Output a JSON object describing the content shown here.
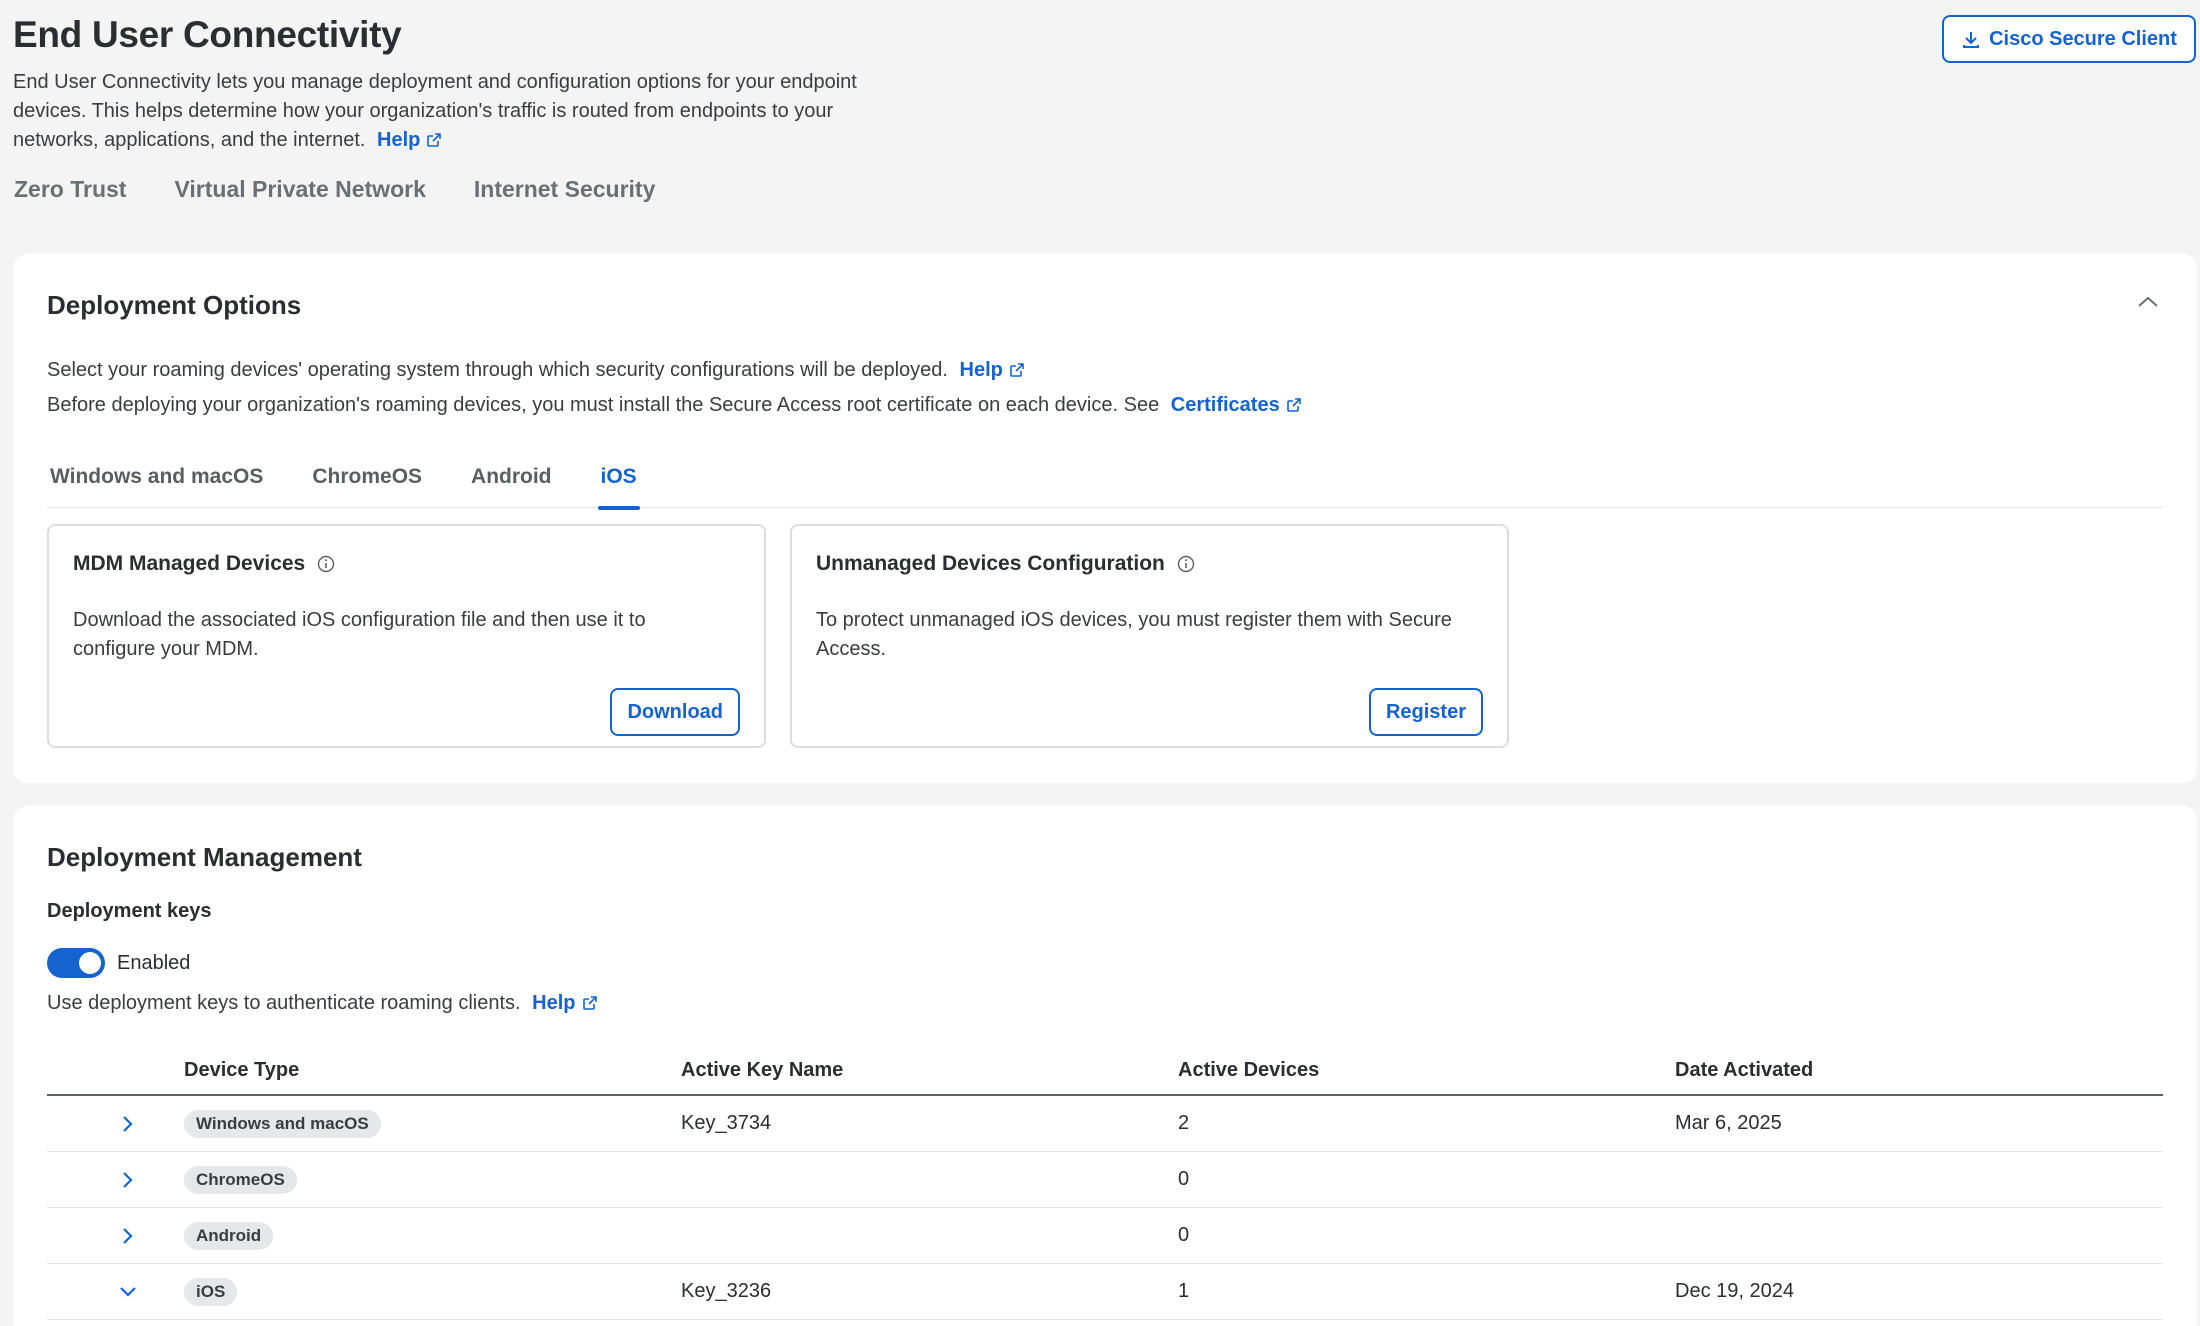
{
  "header": {
    "title": "End User Connectivity",
    "description": "End User Connectivity lets you manage deployment and configuration options for your endpoint devices. This helps determine how your organization's traffic is routed from endpoints to your networks, applications, and the internet.",
    "help_label": "Help",
    "cisco_button_label": "Cisco Secure Client",
    "tabs": [
      "Zero Trust",
      "Virtual Private Network",
      "Internet Security"
    ]
  },
  "deployment_options": {
    "title": "Deployment Options",
    "line1": "Select your roaming devices' operating system through which security configurations will be deployed.",
    "line1_link": "Help",
    "line2": "Before deploying your organization's roaming devices, you must install the Secure Access root certificate on each device. See",
    "line2_link": "Certificates",
    "os_tabs": [
      "Windows and macOS",
      "ChromeOS",
      "Android",
      "iOS"
    ],
    "active_tab": "iOS",
    "cards": [
      {
        "title": "MDM Managed Devices",
        "body": "Download the associated iOS configuration file and then use it to configure your MDM.",
        "button": "Download"
      },
      {
        "title": "Unmanaged Devices Configuration",
        "body": "To protect unmanaged iOS devices, you must register them with Secure Access.",
        "button": "Register"
      }
    ]
  },
  "deployment_management": {
    "title": "Deployment Management",
    "keys_title": "Deployment keys",
    "toggle_label": "Enabled",
    "toggle_on": true,
    "keys_desc": "Use deployment keys to authenticate roaming clients.",
    "keys_help": "Help",
    "table": {
      "headers": [
        "Device Type",
        "Active Key Name",
        "Active Devices",
        "Date Activated"
      ],
      "rows": [
        {
          "device_type": "Windows and macOS",
          "key": "Key_3734",
          "devices": "2",
          "date": "Mar 6, 2025",
          "expanded": false
        },
        {
          "device_type": "ChromeOS",
          "key": "",
          "devices": "0",
          "date": "",
          "expanded": false
        },
        {
          "device_type": "Android",
          "key": "",
          "devices": "0",
          "date": "",
          "expanded": false
        },
        {
          "device_type": "iOS",
          "key": "Key_3236",
          "devices": "1",
          "date": "Dec 19, 2024",
          "expanded": true
        }
      ]
    }
  },
  "colors": {
    "accent": "#1463cf",
    "background": "#f4f4f5",
    "panel": "#ffffff"
  }
}
